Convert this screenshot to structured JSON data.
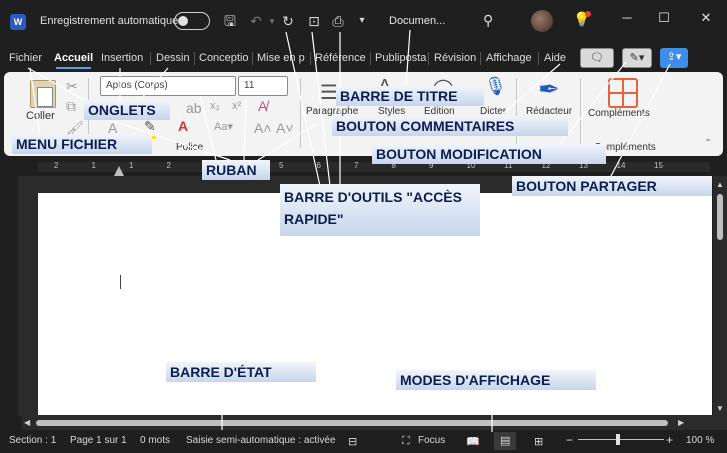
{
  "titlebar": {
    "app_logo": "W",
    "autosave_label": "Enregistrement automatique",
    "doc_title": "Documen...",
    "icons": [
      "save-icon",
      "undo-icon",
      "redo-icon",
      "touch-mode-icon",
      "print-icon",
      "customize-icon",
      "search-icon",
      "lightbulb-icon"
    ],
    "window_buttons": {
      "minimize": "─",
      "maximize": "☐",
      "close": "✕"
    }
  },
  "tabs": [
    "Fichier",
    "Accueil",
    "Insertion",
    "Dessin",
    "Conceptio",
    "Mise en p",
    "Référence",
    "Publiposta",
    "Révision",
    "Affichage",
    "Aide"
  ],
  "ribbon": {
    "paste_label": "Coller",
    "font_name": "Aptos (Corps)",
    "font_size": "11",
    "font_group": "Police",
    "paragraph_label": "Paragraphe",
    "styles_label": "Styles",
    "edition_label": "Édition",
    "dicter_label": "Dicter",
    "redacteur_label": "Rédacteur",
    "complements_label": "Compléments",
    "complements_group": "Compléments"
  },
  "statusbar": {
    "section": "Section : 1",
    "page": "Page 1 sur 1",
    "words": "0 mots",
    "autocomplete": "Saisie semi-automatique : activée",
    "focus": "Focus",
    "zoom": "100 %",
    "zoom_minus": "−",
    "zoom_plus": "+"
  },
  "ruler_numbers": [
    "2",
    "1",
    "1",
    "2",
    "3",
    "4",
    "5",
    "6",
    "7",
    "8",
    "9",
    "10",
    "11",
    "12",
    "13",
    "14",
    "15"
  ],
  "callouts": {
    "barre_titre": "BARRE DE TITRE",
    "onglets": "ONGLETS",
    "menu_fichier": "MENU FICHIER",
    "bouton_commentaires": "BOUTON COMMENTAIRES",
    "bouton_modification": "BOUTON MODIFICATION",
    "ruban": "RUBAN",
    "barre_outils": "BARRE D'OUTILS \"ACCÈS RAPIDE\"",
    "bouton_partager": "BOUTON PARTAGER",
    "barre_etat": "BARRE D'ÉTAT",
    "modes_affichage": "MODES D'AFFICHAGE"
  },
  "colors": {
    "accent": "#3d8ee8",
    "word_blue": "#2b5bc0",
    "callout_text": "#0c1e4f",
    "complements_orange": "#e8603c"
  }
}
